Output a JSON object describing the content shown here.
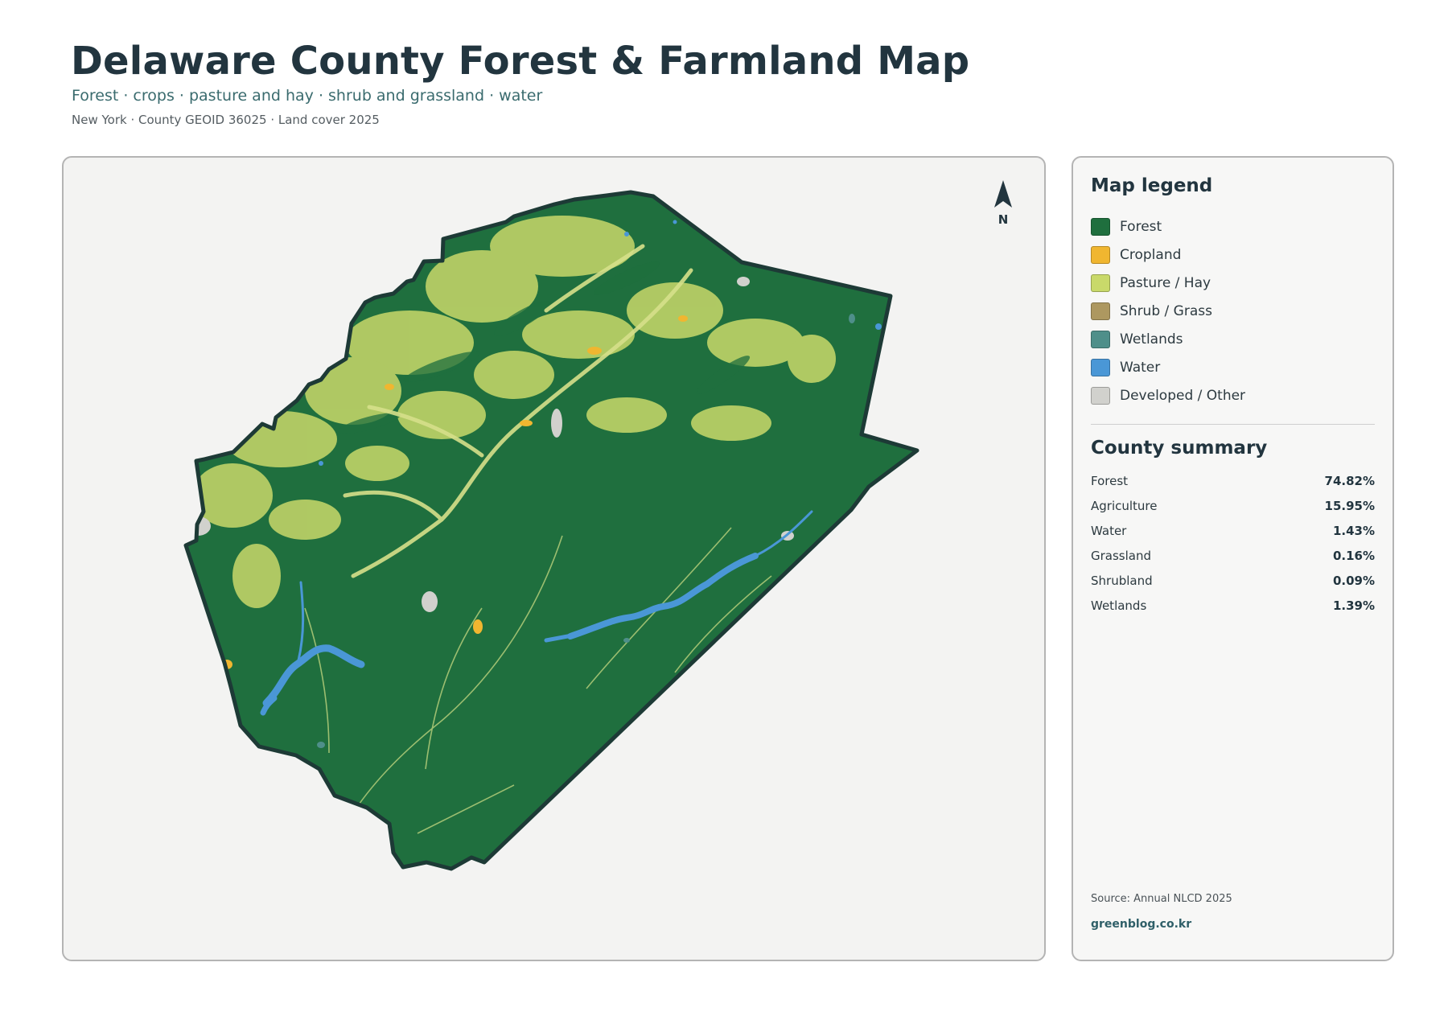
{
  "header": {
    "title": "Delaware County Forest & Farmland Map",
    "subtitle": "Forest · crops · pasture and hay · shrub and grassland · water",
    "meta": "New York · County GEOID 36025 · Land cover 2025"
  },
  "map": {
    "north_label": "N",
    "colors": {
      "forest": "#1f6f3e",
      "cropland": "#f0b630",
      "pasture": "#c9d96a",
      "shrub": "#ad9860",
      "wetlands": "#4f8f8a",
      "water": "#4a97d6",
      "developed": "#d1d1cd",
      "outline": "#1d3a36",
      "background": "#f3f3f2"
    }
  },
  "legend": {
    "title": "Map legend",
    "items": [
      {
        "label": "Forest",
        "color": "#1f6f3e"
      },
      {
        "label": "Cropland",
        "color": "#f0b630"
      },
      {
        "label": "Pasture / Hay",
        "color": "#c9d96a"
      },
      {
        "label": "Shrub / Grass",
        "color": "#ad9860"
      },
      {
        "label": "Wetlands",
        "color": "#4f8f8a"
      },
      {
        "label": "Water",
        "color": "#4a97d6"
      },
      {
        "label": "Developed / Other",
        "color": "#d1d1cd"
      }
    ]
  },
  "summary": {
    "title": "County summary",
    "rows": [
      {
        "label": "Forest",
        "value": "74.82%"
      },
      {
        "label": "Agriculture",
        "value": "15.95%"
      },
      {
        "label": "Water",
        "value": "1.43%"
      },
      {
        "label": "Grassland",
        "value": "0.16%"
      },
      {
        "label": "Shrubland",
        "value": "0.09%"
      },
      {
        "label": "Wetlands",
        "value": "1.39%"
      }
    ]
  },
  "footer": {
    "source": "Source: Annual NLCD 2025",
    "credit": "greenblog.co.kr"
  }
}
